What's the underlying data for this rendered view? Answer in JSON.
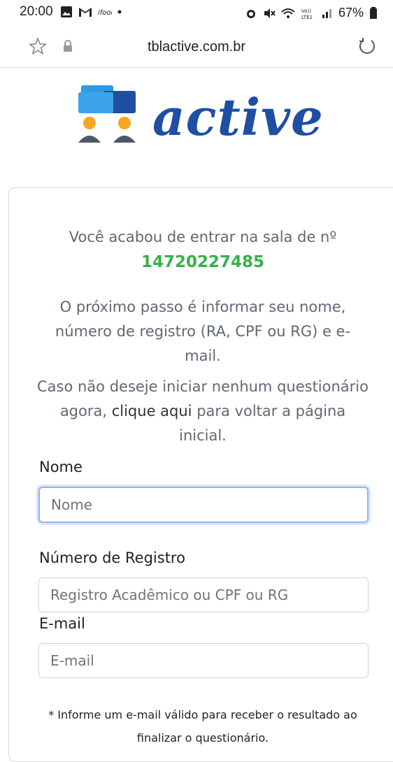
{
  "status_bar": {
    "time": "20:00",
    "battery": "67%"
  },
  "browser": {
    "url": "tblactive.com.br"
  },
  "logo": {
    "text": "active"
  },
  "content": {
    "intro": "Você acabou de entrar na sala de nº",
    "room_number": "14720227485",
    "next_step": "O próximo passo é informar seu nome, número de registro (RA, CPF ou RG) e e-mail.",
    "cancel_before": "Caso não deseje iniciar nenhum questionário agora, ",
    "cancel_link": "clique aqui",
    "cancel_after": " para voltar a página inicial."
  },
  "form": {
    "name_label": "Nome",
    "name_placeholder": "Nome",
    "registry_label": "Número de Registro",
    "registry_placeholder": "Registro Acadêmico ou CPF ou RG",
    "email_label": "E-mail",
    "email_placeholder": "E-mail",
    "note": "* Informe um e-mail válido para receber o resultado ao finalizar o questionário."
  }
}
